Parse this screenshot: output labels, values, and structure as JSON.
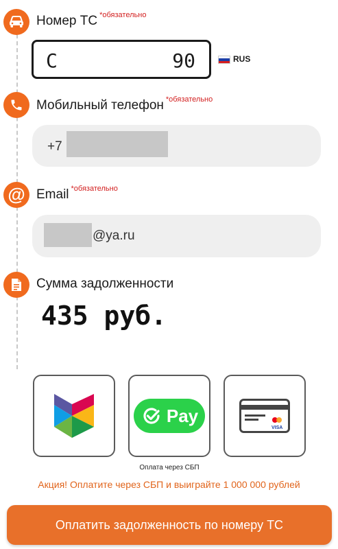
{
  "plate": {
    "label": "Номер ТС",
    "required": "*обязательно",
    "letter": "С",
    "region_digits": "90",
    "country_code": "RUS",
    "flag_colors": [
      "#ffffff",
      "#1c3fa8",
      "#d81e1e"
    ]
  },
  "phone": {
    "label": "Мобильный телефон",
    "required": "*обязательно",
    "prefix": "+7"
  },
  "email": {
    "label": "Email",
    "required": "*обязательно",
    "domain": "@ya.ru"
  },
  "debt": {
    "label": "Сумма задолженности",
    "value": "435 руб."
  },
  "payment": {
    "methods": [
      {
        "icon": "sbp-logo-icon"
      },
      {
        "icon": "sbp-pay-icon",
        "text": "Pay"
      },
      {
        "icon": "bank-card-icon",
        "card_brand": "VISA"
      }
    ],
    "sbp_caption": "Оплата через СБП",
    "promo": "Акция! Оплатите через СБП и выиграйте 1 000 000 рублей"
  },
  "submit_button": "Оплатить задолженность по номеру ТС",
  "colors": {
    "accent": "#f06a1e",
    "promo": "#e1641b",
    "button": "#e8702a",
    "required": "#d21e1e",
    "pay_green": "#2bd14a"
  }
}
